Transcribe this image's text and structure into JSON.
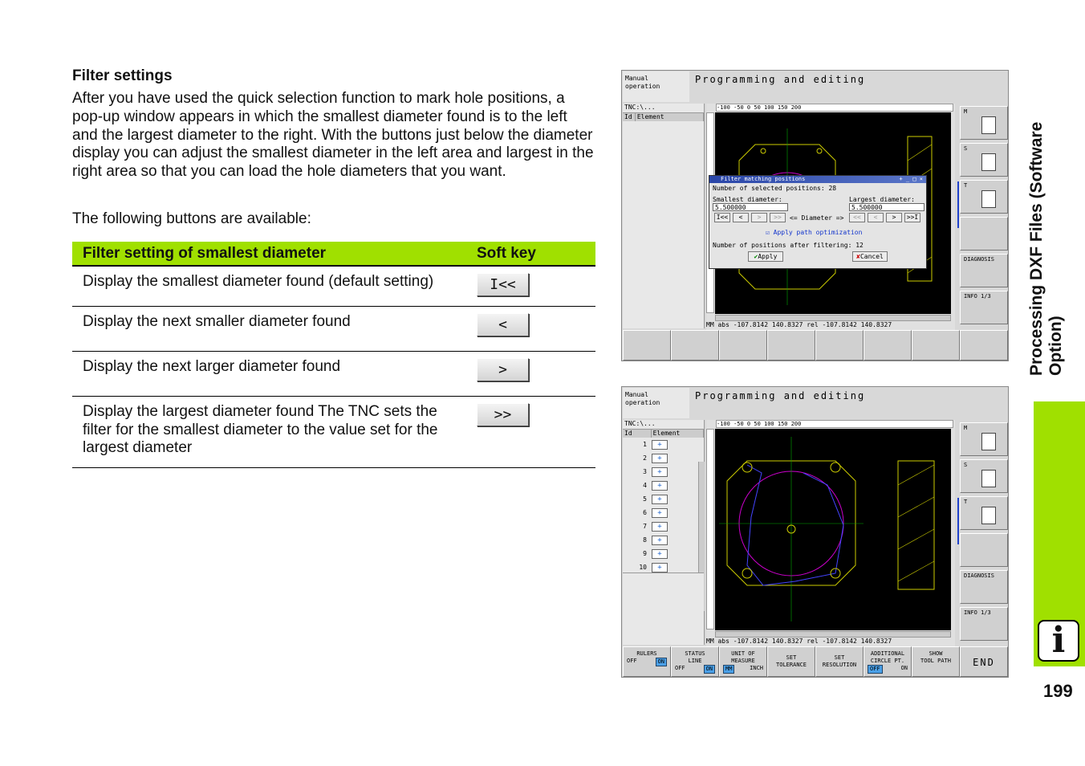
{
  "heading": "Filter settings",
  "paragraph": "After you have used the quick selection function to mark hole positions, a pop-up window appears in which the smallest diameter found is to the left and the largest diameter to the right. With the buttons just below the diameter display you can adjust the smallest diameter in the left area and largest in the right area so that you can load the hole diameters that you want.",
  "paragraph2": "The following buttons are available:",
  "table": {
    "col1": "Filter setting of smallest diameter",
    "col2": "Soft key",
    "rows": [
      {
        "desc": "Display the smallest diameter found (default setting)",
        "key": "I<<"
      },
      {
        "desc": "Display the next smaller diameter found",
        "key": "<"
      },
      {
        "desc": "Display the next larger diameter found",
        "key": ">"
      },
      {
        "desc": "Display the largest diameter found The TNC sets the filter for the smallest diameter to the value set for the largest diameter",
        "key": ">>"
      }
    ]
  },
  "side_title": "Processing DXF Files (Software Option)",
  "info_icon": "i",
  "page_number": "199",
  "screen": {
    "mode_label_1": "Manual",
    "mode_label_2": "operation",
    "title": "Programming and editing",
    "tree_path": "TNC:\\...",
    "col_id": "Id",
    "col_element": "Element",
    "ruler_h": "-100  -50    0    50   100  150  200",
    "status": "MM   abs -107.8142 140.8327 rel -107.8142 140.8327",
    "right_keys": [
      "M",
      "S",
      "T",
      "",
      "DIAGNOSIS",
      "INFO 1/3"
    ],
    "rows": [
      "1",
      "2",
      "3",
      "4",
      "5",
      "6",
      "7",
      "8",
      "9",
      "10"
    ]
  },
  "popup": {
    "title": "Filter matching positions",
    "selected": "Number of selected positions: 28",
    "smallest_label": "Smallest diameter:",
    "largest_label": "Largest diameter:",
    "smallest_value": "5.500000",
    "largest_value": "5.500000",
    "diameter_label": "<= Diameter =>",
    "btn_first": "I<<",
    "btn_prev": "<",
    "btn_next_dis": ">",
    "btn_last_dis": ">>",
    "btn_first_r": "<<",
    "btn_prev_r": "<",
    "btn_next_r": ">",
    "btn_last_r": ">>I",
    "apply_path": "Apply path optimization",
    "after_filter": "Number of positions after filtering: 12",
    "apply": "Apply",
    "cancel": "Cancel"
  },
  "bottom_keys": [
    {
      "l1": "RULERS",
      "l2": "",
      "off": "OFF",
      "on": "ON",
      "sel": "on"
    },
    {
      "l1": "STATUS",
      "l2": "LINE",
      "off": "OFF",
      "on": "ON",
      "sel": "on"
    },
    {
      "l1": "UNIT OF",
      "l2": "MEASURE",
      "off": "MM",
      "on": "INCH",
      "sel": "off"
    },
    {
      "l1": "SET",
      "l2": "TOLERANCE",
      "off": "",
      "on": "",
      "sel": ""
    },
    {
      "l1": "SET",
      "l2": "RESOLUTION",
      "off": "",
      "on": "",
      "sel": ""
    },
    {
      "l1": "ADDITIONAL",
      "l2": "CIRCLE PT.",
      "off": "OFF",
      "on": "ON",
      "sel": "off"
    },
    {
      "l1": "SHOW",
      "l2": "TOOL PATH",
      "off": "",
      "on": "",
      "sel": ""
    }
  ],
  "end_key": "END"
}
